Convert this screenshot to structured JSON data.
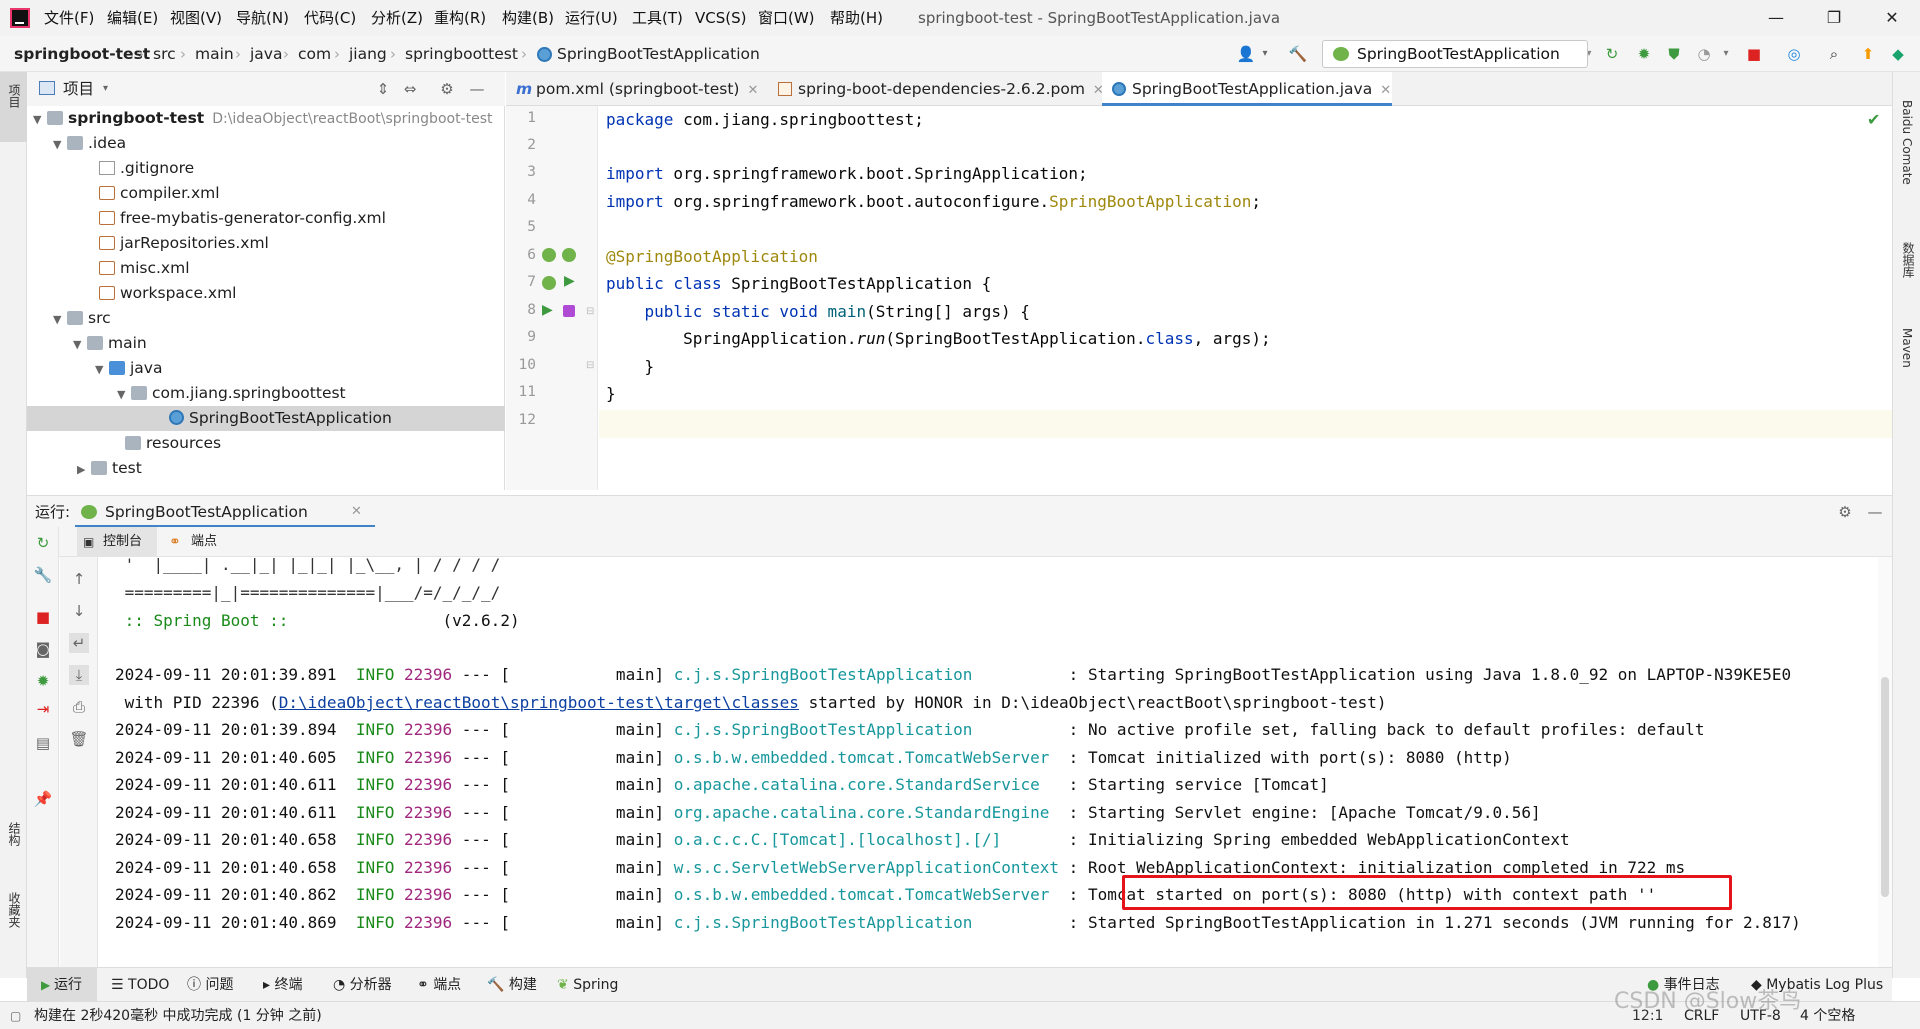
{
  "menu": [
    "文件(F)",
    "编辑(E)",
    "视图(V)",
    "导航(N)",
    "代码(C)",
    "分析(Z)",
    "重构(R)",
    "构建(B)",
    "运行(U)",
    "工具(T)",
    "VCS(S)",
    "窗口(W)",
    "帮助(H)"
  ],
  "window_title": "springboot-test - SpringBootTestApplication.java",
  "window_controls": {
    "minimize": "—",
    "maximize": "❐",
    "close": "✕"
  },
  "breadcrumb": [
    "springboot-test",
    "src",
    "main",
    "java",
    "com",
    "jiang",
    "springboottest",
    "SpringBootTestApplication"
  ],
  "run_config": "SpringBootTestApplication",
  "left_strip": {
    "project": "项目",
    "structure": "结构",
    "favorites": "收藏夹"
  },
  "right_strip": {
    "comate": "Baidu Comate",
    "database": "数据库",
    "maven": "Maven"
  },
  "project": {
    "title": "项目",
    "root": "springboot-test",
    "root_path": "D:\\ideaObject\\reactBoot\\springboot-test",
    "idea": ".idea",
    "idea_files": [
      ".gitignore",
      "compiler.xml",
      "free-mybatis-generator-config.xml",
      "jarRepositories.xml",
      "misc.xml",
      "workspace.xml"
    ],
    "src": "src",
    "main": "main",
    "java": "java",
    "package": "com.jiang.springboottest",
    "app_class": "SpringBootTestApplication",
    "resources": "resources",
    "test": "test"
  },
  "tabs": [
    {
      "label": "pom.xml (springboot-test)",
      "icon_letter": "m"
    },
    {
      "label": "spring-boot-dependencies-2.6.2.pom",
      "icon_letter": ""
    },
    {
      "label": "SpringBootTestApplication.java",
      "icon_letter": ""
    }
  ],
  "editor": {
    "line_numbers": [
      "1",
      "2",
      "3",
      "4",
      "5",
      "6",
      "7",
      "8",
      "9",
      "10",
      "11",
      "12"
    ],
    "l1_kw": "package",
    "l1_rest": " com.jiang.springboottest;",
    "l3_kw": "import",
    "l3_rest": " org.springframework.boot.SpringApplication;",
    "l4_kw": "import",
    "l4_rest": " org.springframework.boot.autoconfigure.",
    "l4_ann": "SpringBootApplication",
    "l4_end": ";",
    "l6_ann": "@SpringBootApplication",
    "l7_kw": "public class",
    "l7_rest": " SpringBootTestApplication {",
    "l8_kw": "public static void",
    "l8_fn": " main",
    "l8_rest": "(String[] args) {",
    "l9_a": "SpringApplication.",
    "l9_run": "run",
    "l9_b": "(SpringBootTestApplication.",
    "l9_cls": "class",
    "l9_c": ", args);",
    "l10": "}",
    "l11": "}"
  },
  "run": {
    "label": "运行:",
    "tab": "SpringBootTestApplication",
    "console_tab": "控制台",
    "endpoints_tab": "端点"
  },
  "console": {
    "banner1": " '  |____| .__|_| |_|_| |_\\__, | / / / /",
    "banner2": " =========|_|==============|___/=/_/_/_/",
    "banner3": " :: Spring Boot ::",
    "banner3_ver": "(v2.6.2)",
    "logs": [
      {
        "ts": "2024-09-11 20:01:39.891",
        "level": "INFO",
        "pid": "22396",
        "mid": " --- [           main] ",
        "cls": "c.j.s.SpringBootTestApplication         ",
        "msg": " : Starting SpringBootTestApplication using Java 1.8.0_92 on LAPTOP-N39KE5E0"
      },
      {
        "ts": "2024-09-11 20:01:39.894",
        "level": "INFO",
        "pid": "22396",
        "mid": " --- [           main] ",
        "cls": "c.j.s.SpringBootTestApplication         ",
        "msg": " : No active profile set, falling back to default profiles: default"
      },
      {
        "ts": "2024-09-11 20:01:40.605",
        "level": "INFO",
        "pid": "22396",
        "mid": " --- [           main] ",
        "cls": "o.s.b.w.embedded.tomcat.TomcatWebServer ",
        "msg": " : Tomcat initialized with port(s): 8080 (http)"
      },
      {
        "ts": "2024-09-11 20:01:40.611",
        "level": "INFO",
        "pid": "22396",
        "mid": " --- [           main] ",
        "cls": "o.apache.catalina.core.StandardService  ",
        "msg": " : Starting service [Tomcat]"
      },
      {
        "ts": "2024-09-11 20:01:40.611",
        "level": "INFO",
        "pid": "22396",
        "mid": " --- [           main] ",
        "cls": "org.apache.catalina.core.StandardEngine ",
        "msg": " : Starting Servlet engine: [Apache Tomcat/9.0.56]"
      },
      {
        "ts": "2024-09-11 20:01:40.658",
        "level": "INFO",
        "pid": "22396",
        "mid": " --- [           main] ",
        "cls": "o.a.c.c.C.[Tomcat].[localhost].[/]      ",
        "msg": " : Initializing Spring embedded WebApplicationContext"
      },
      {
        "ts": "2024-09-11 20:01:40.658",
        "level": "INFO",
        "pid": "22396",
        "mid": " --- [           main] ",
        "cls": "w.s.c.ServletWebServerApplicationContext",
        "msg": " : Root WebApplicationContext: initialization completed in 722 ms"
      },
      {
        "ts": "2024-09-11 20:01:40.862",
        "level": "INFO",
        "pid": "22396",
        "mid": " --- [           main] ",
        "cls": "o.s.b.w.embedded.tomcat.TomcatWebServer ",
        "msg": " : Tomcat started on port(s): 8080 (http) with context path ''"
      },
      {
        "ts": "2024-09-11 20:01:40.869",
        "level": "INFO",
        "pid": "22396",
        "mid": " --- [           main] ",
        "cls": "c.j.s.SpringBootTestApplication         ",
        "msg": " : Started SpringBootTestApplication in 1.271 seconds (JVM running for 2.817)"
      }
    ],
    "pid_line_a": " with PID 22396 (",
    "pid_line_link": "D:\\ideaObject\\reactBoot\\springboot-test\\target\\classes",
    "pid_line_b": " started by HONOR in D:\\ideaObject\\reactBoot\\springboot-test)"
  },
  "bottom_tabs": [
    "运行",
    "TODO",
    "问题",
    "终端",
    "分析器",
    "端点",
    "构建",
    "Spring"
  ],
  "bottom_right": [
    "事件日志",
    "Mybatis Log Plus"
  ],
  "status": {
    "message": "构建在 2秒420毫秒 中成功完成 (1 分钟 之前)",
    "pos": "12:1",
    "crlf": "CRLF",
    "enc": "UTF-8",
    "indent": "4 个空格",
    "watermark": "CSDN @Slow茶鸟"
  },
  "colors": {
    "accent": "#4083c9",
    "highlight_box": "#e5141b"
  }
}
